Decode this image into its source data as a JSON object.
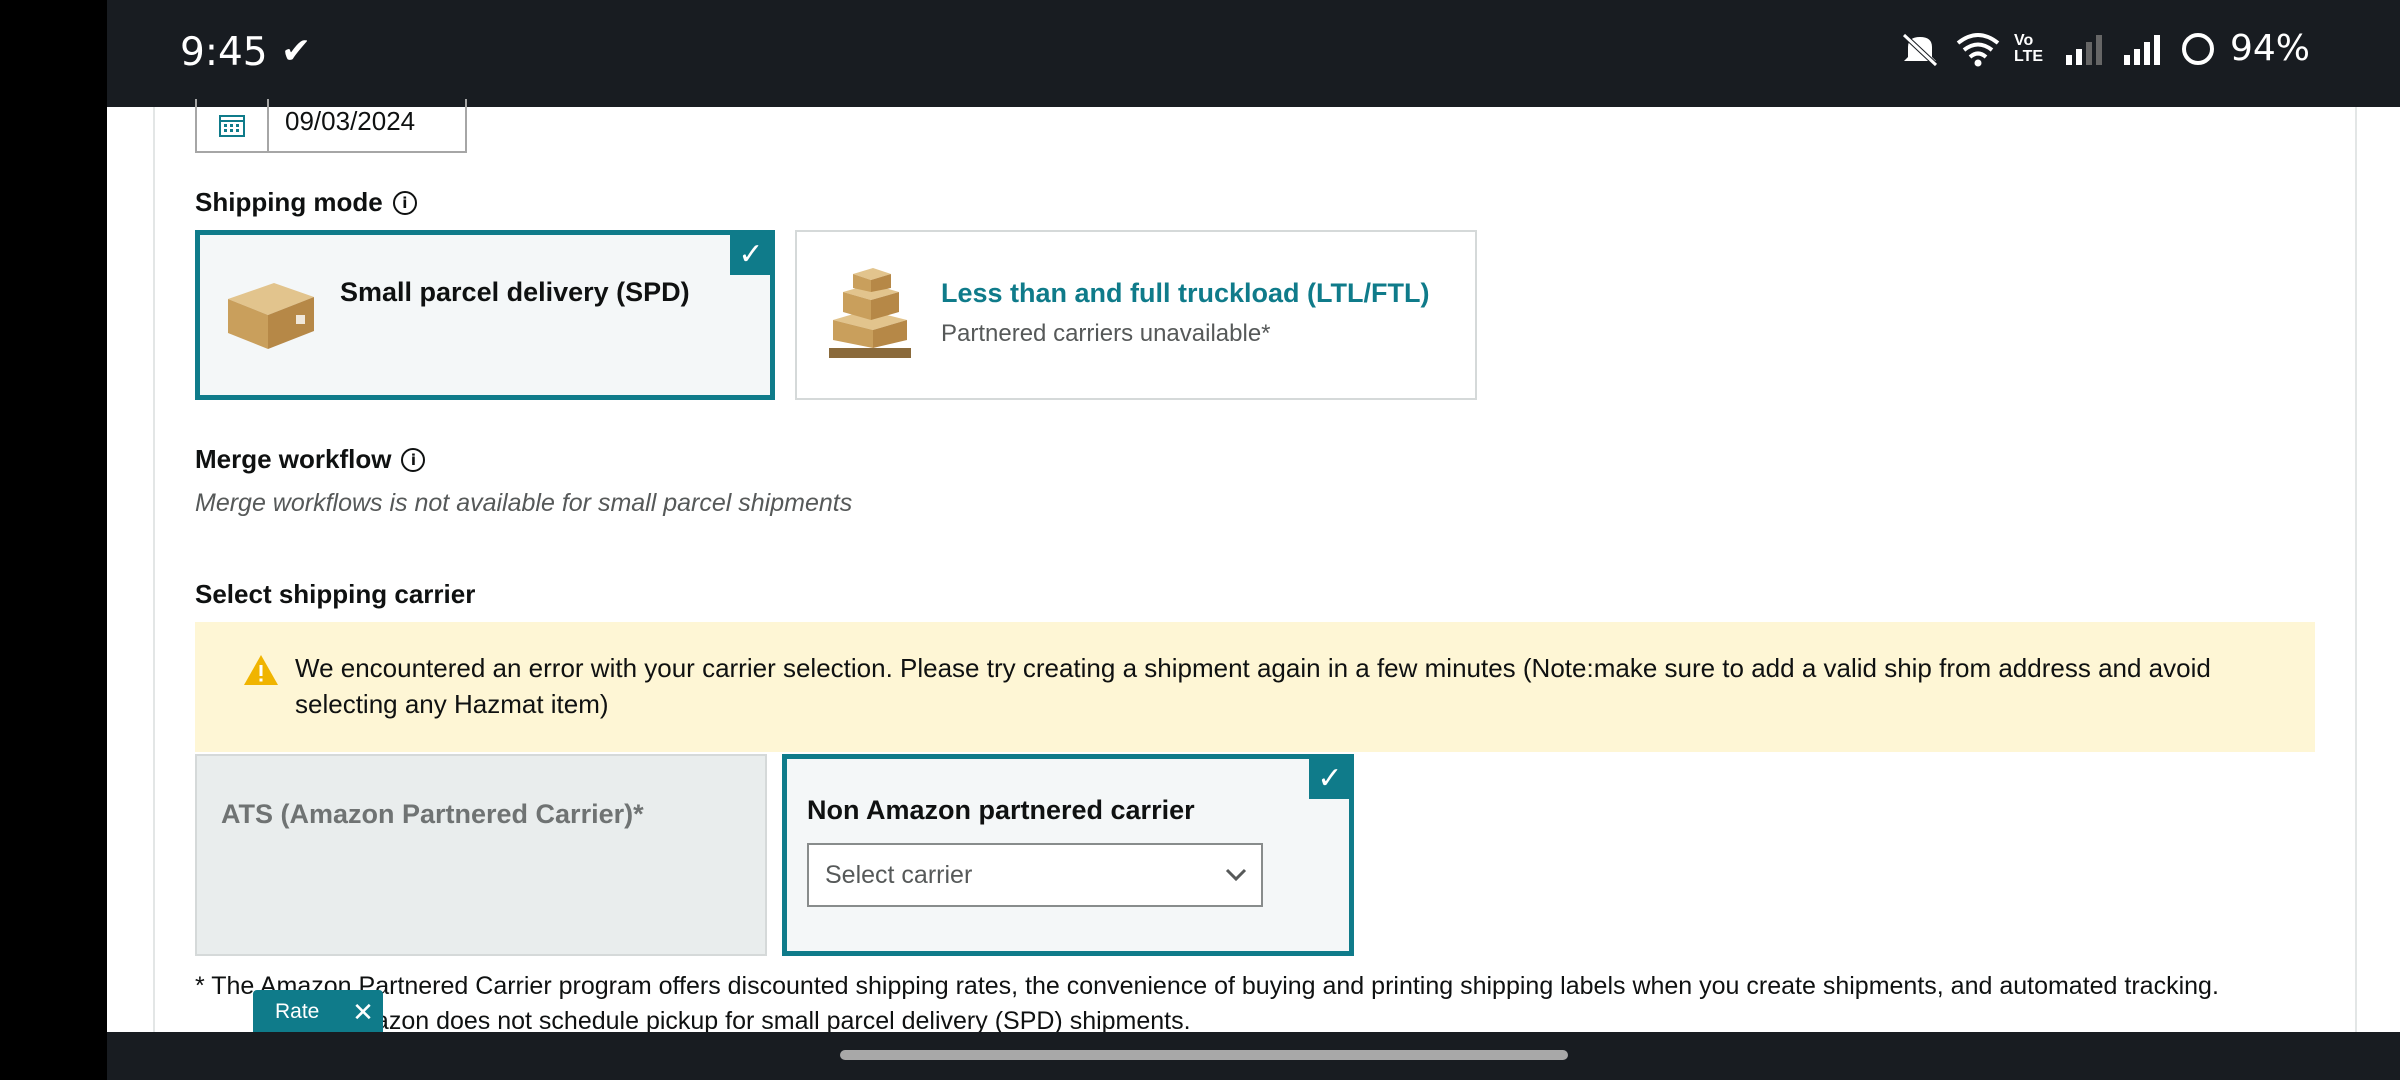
{
  "status_bar": {
    "time": "9:45",
    "battery": "94%",
    "network_label": "Vo LTE"
  },
  "form": {
    "date_value": "09/03/2024",
    "shipping_mode": {
      "label": "Shipping mode",
      "options": [
        {
          "title": "Small parcel delivery (SPD)",
          "subtitle": "",
          "selected": true
        },
        {
          "title": "Less than and full truckload (LTL/FTL)",
          "subtitle": "Partnered carriers unavailable*",
          "selected": false
        }
      ]
    },
    "merge_workflow": {
      "label": "Merge workflow",
      "note": "Merge workflows is not available for small parcel shipments"
    },
    "carrier": {
      "label": "Select shipping carrier",
      "alert": "We encountered an error with your carrier selection. Please try creating a shipment again in a few minutes (Note:make sure to add a valid ship from address and avoid selecting any Hazmat item)",
      "options": [
        {
          "title": "ATS (Amazon Partnered Carrier)*",
          "disabled": true
        },
        {
          "title": "Non Amazon partnered carrier",
          "selected": true
        }
      ],
      "select_placeholder": "Select carrier"
    },
    "footnote_line1": "* The Amazon Partnered Carrier program offers discounted shipping rates, the convenience of buying and printing shipping labels when you create shipments, and automated tracking.",
    "footnote_line2": "at Amazon does not schedule pickup for small parcel delivery (SPD) shipments."
  },
  "rate_widget": {
    "label": "Rate",
    "close": "✕"
  },
  "colors": {
    "accent": "#0f7b8a",
    "alert_bg": "#fef6d5",
    "status_bar": "#181c21"
  }
}
